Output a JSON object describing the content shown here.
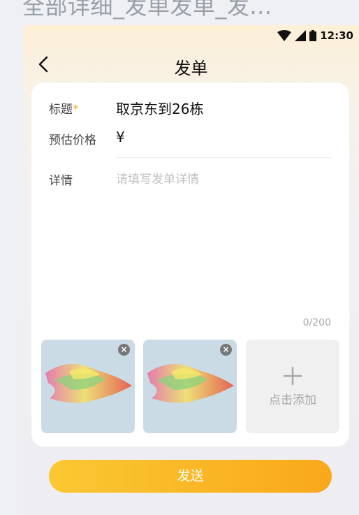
{
  "page": {
    "heading": "全部详细_发单发单_发..."
  },
  "status_bar": {
    "time": "12:30"
  },
  "nav": {
    "title": "发单"
  },
  "form": {
    "title_label": "标题",
    "required_mark": "*",
    "title_value": "取京东到26栋",
    "price_label": "预估价格",
    "price_value": "¥",
    "detail_label": "详情",
    "detail_placeholder": "请填写发单详情",
    "char_counter": "0/200"
  },
  "images": {
    "remove_glyph": "×",
    "add_label": "点击添加"
  },
  "actions": {
    "send_label": "发送"
  },
  "colors": {
    "accent": "#f9a81b",
    "accent_light": "#fbc833",
    "star": "#f4a623"
  }
}
